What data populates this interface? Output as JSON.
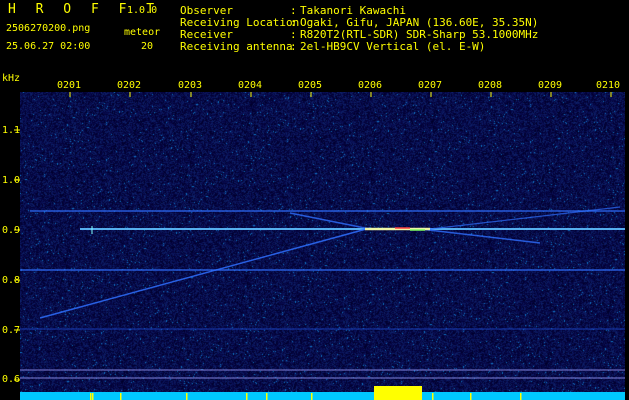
{
  "header": {
    "app_title": "H R O F F T",
    "version": "1.0.0",
    "filename": "2506270200.png",
    "datetime": "25.06.27 02:00",
    "meteor_label": "meteor",
    "meteor_count": "20"
  },
  "info": {
    "observer_key": "Observer",
    "observer_val": "Takanori Kawachi",
    "location_key": "Receiving Location",
    "location_val": "Ogaki, Gifu, JAPAN (136.60E, 35.35N)",
    "receiver_key": "Receiver",
    "receiver_val": "R820T2(RTL-SDR) SDR-Sharp 53.1000MHz",
    "antenna_key": "Receiving antenna",
    "antenna_val": "2el-HB9CV Vertical (el. E-W)",
    "separator": ":"
  },
  "axis": {
    "unit": "kHz",
    "time_ticks": [
      "0201",
      "0202",
      "0203",
      "0204",
      "0205",
      "0206",
      "0207",
      "0208",
      "0209",
      "0210"
    ],
    "freq_ticks": [
      "1.1",
      "1.0",
      "0.9",
      "0.8",
      "0.7",
      "0.6"
    ]
  },
  "colors": {
    "text": "#ffff00",
    "background_noise": "#000060",
    "signal": "#40a0ff",
    "bottom_bar": "#00c8ff",
    "meteor_burst": "#ffff00"
  }
}
